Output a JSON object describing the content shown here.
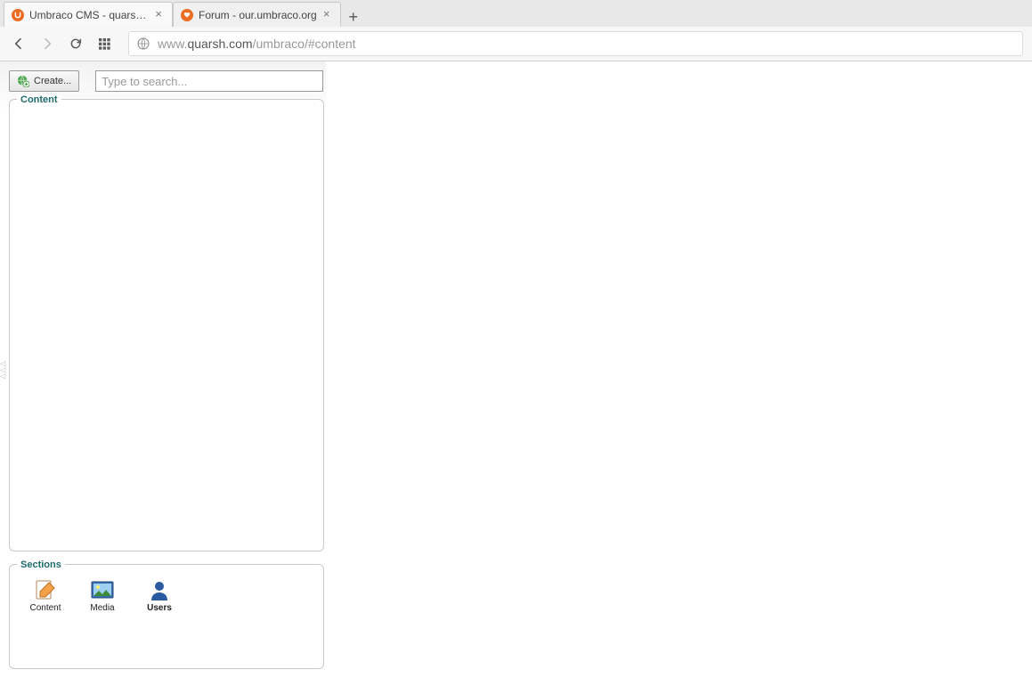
{
  "browser": {
    "tabs": [
      {
        "title": "Umbraco CMS - quarsh.co",
        "icon": "umbraco"
      },
      {
        "title": "Forum - our.umbraco.org",
        "icon": "umbraco-heart"
      }
    ],
    "url_prefix": "www.",
    "url_host": "quarsh.com",
    "url_path": "/umbraco/#content"
  },
  "app": {
    "create_label": "Create...",
    "search_placeholder": "Type to search...",
    "panels": {
      "content_title": "Content",
      "sections_title": "Sections"
    },
    "sections": [
      {
        "label": "Content"
      },
      {
        "label": "Media"
      },
      {
        "label": "Users"
      }
    ]
  }
}
